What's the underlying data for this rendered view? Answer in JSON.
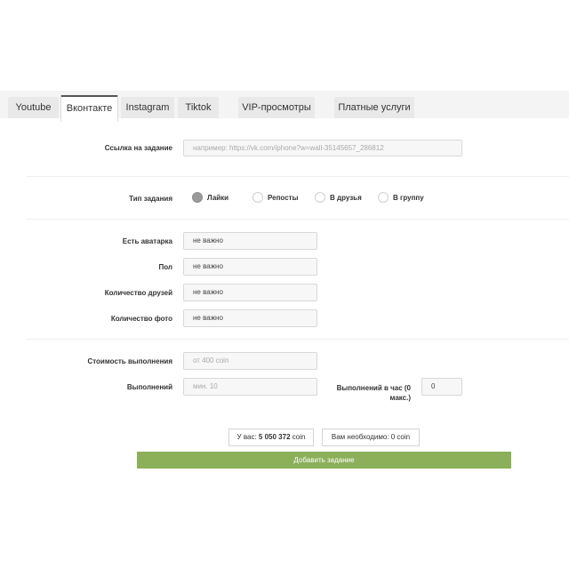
{
  "tabs": [
    {
      "label": "Youtube"
    },
    {
      "label": "Вконтакте"
    },
    {
      "label": "Instagram"
    },
    {
      "label": "Tiktok"
    },
    {
      "label": "VIP-просмотры"
    },
    {
      "label": "Платные услуги"
    }
  ],
  "active_tab": "Вконтакте",
  "form": {
    "link": {
      "label": "Ссылка на задание",
      "placeholder": "например: https://vk.com/iphone?w=wall-35145657_286812"
    },
    "task_type": {
      "label": "Тип задания",
      "options": [
        "Лайки",
        "Репосты",
        "В друзья",
        "В группу"
      ],
      "selected": "Лайки"
    },
    "has_avatar": {
      "label": "Есть аватарка",
      "value": "не важно"
    },
    "gender": {
      "label": "Пол",
      "value": "не важно"
    },
    "friends_count": {
      "label": "Количество друзей",
      "value": "не важно"
    },
    "photos_count": {
      "label": "Количество фото",
      "value": "не важно"
    },
    "cost": {
      "label": "Стоимость выполнения",
      "placeholder": "от 400 coin"
    },
    "completions": {
      "label": "Выполнений",
      "placeholder": "мин. 10"
    },
    "per_hour": {
      "label_line1": "Выполнений в час (0",
      "label_line2": "макс.)",
      "value": "0"
    }
  },
  "balance": {
    "have_prefix": "У вас:",
    "have_value": "5 050 372",
    "have_unit": "coin",
    "need_text": "Вам необходимо: 0 coin"
  },
  "submit_label": "Добавить задание",
  "colors": {
    "accent": "#8cb05a"
  }
}
